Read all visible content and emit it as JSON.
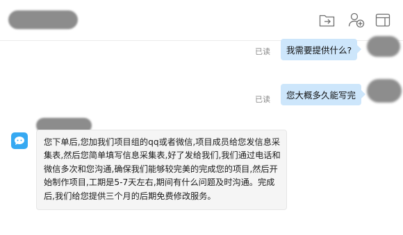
{
  "messages": [
    {
      "direction": "outgoing",
      "text": "我需要提供什么?",
      "status": "已读"
    },
    {
      "direction": "outgoing",
      "text": "您大概多久能写完",
      "status": "已读"
    },
    {
      "direction": "incoming",
      "text": "您下单后,您加我们项目组的qq或者微信,项目成员给您发信息采集表,然后您简单填写信息采集表,好了发给我们,我们通过电话和微信多次和您沟通,确保我们能够较完美的完成您的项目,然后开始制作项目,工期是5-7天左右,期间有什么问题及时沟通。完成后,我们给您提供三个月的后期免费修改服务。"
    }
  ],
  "icons": {
    "header": [
      "send-file-icon",
      "add-member-icon",
      "sidebar-toggle-icon"
    ],
    "bot_avatar": "chat-bubble-icon"
  },
  "colors": {
    "outgoing_bubble": "#cde6fb",
    "incoming_bubble": "#f5f5f5",
    "bot_avatar": "#36a9f2",
    "read_status": "#8a8a8a"
  }
}
